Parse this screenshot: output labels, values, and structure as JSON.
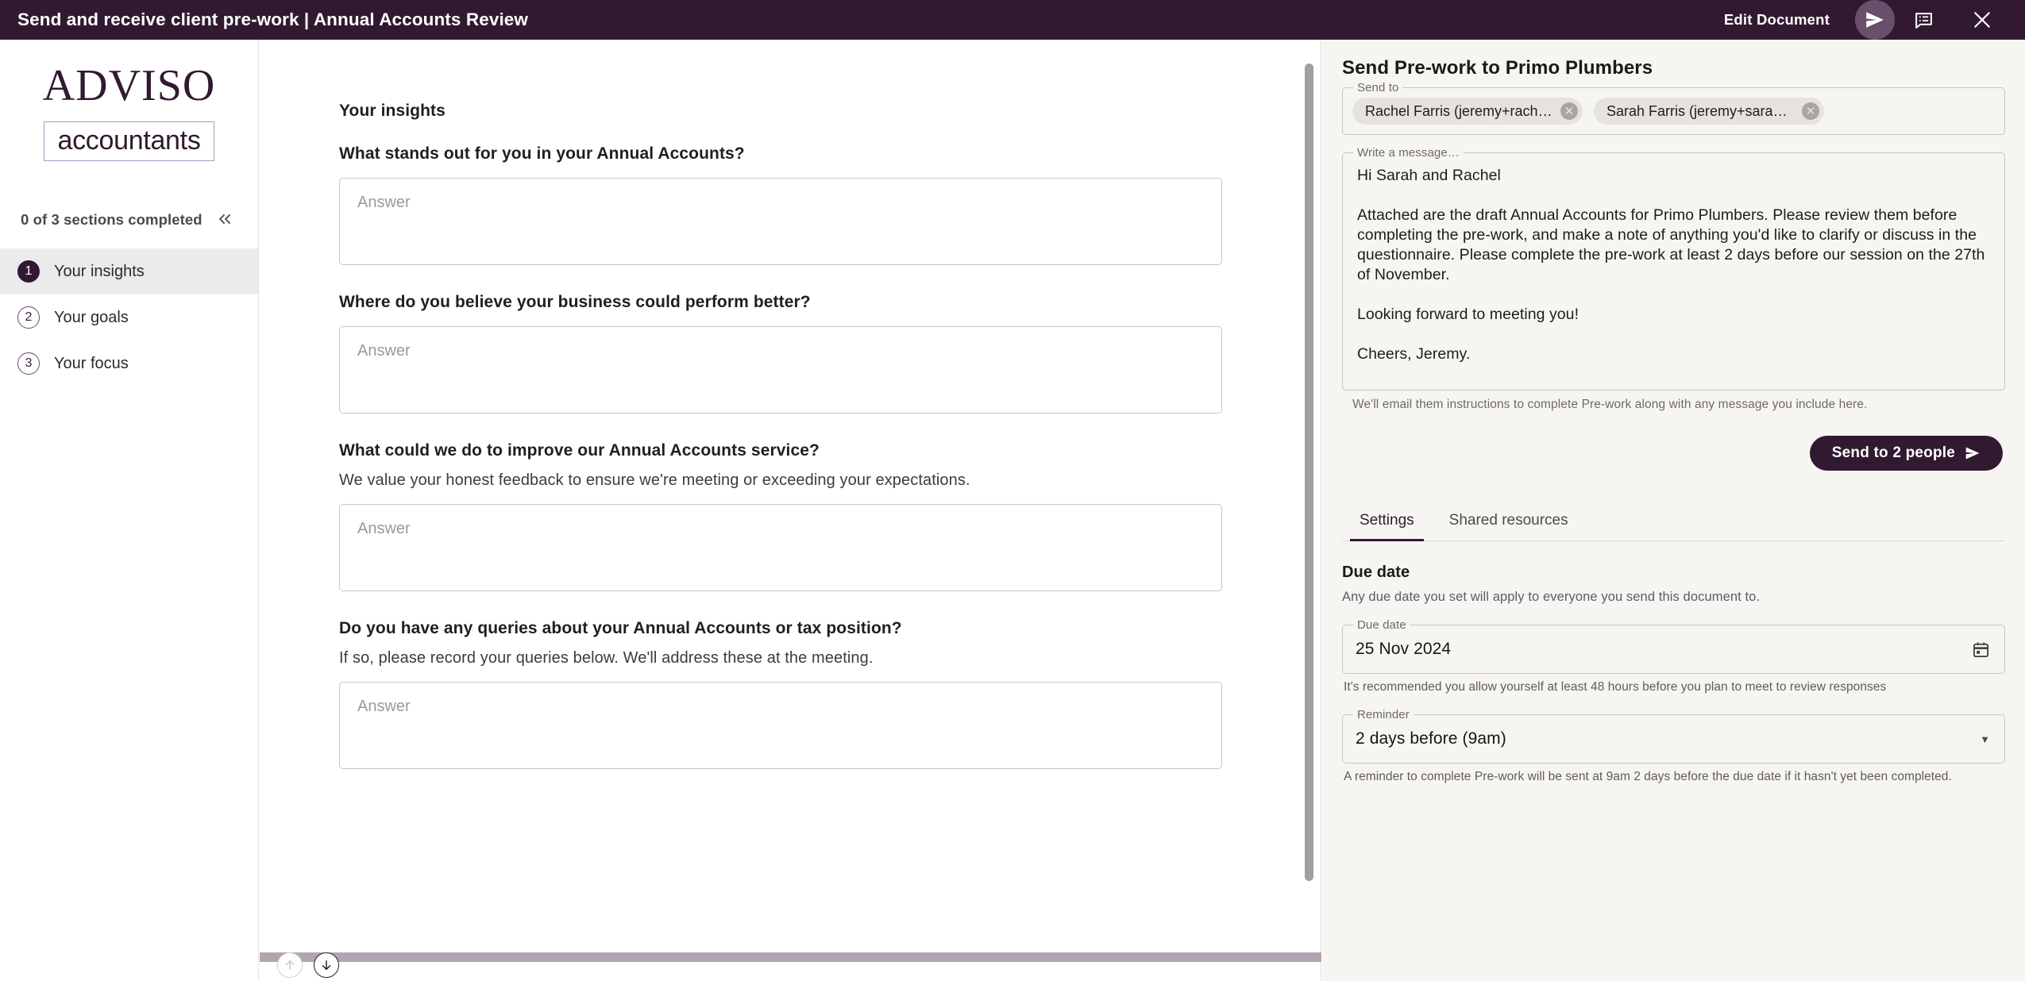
{
  "header": {
    "title": "Send and receive client pre-work | Annual Accounts Review",
    "edit_document_label": "Edit Document",
    "send_icon": "send-plane-icon",
    "comments_icon": "comments-icon",
    "close_icon": "close-icon",
    "background_color": "#311A31"
  },
  "sidebar": {
    "brand_name": "ADVISO",
    "brand_sub": "accountants",
    "progress_text": "0 of 3 sections completed",
    "collapse_icon": "chevron-double-left-icon",
    "items": [
      {
        "num": "1",
        "label": "Your insights",
        "active": true
      },
      {
        "num": "2",
        "label": "Your goals",
        "active": false
      },
      {
        "num": "3",
        "label": "Your focus",
        "active": false
      }
    ]
  },
  "document": {
    "section_title": "Your insights",
    "answer_placeholder": "Answer",
    "questions": [
      {
        "title": "What stands out for you in your Annual Accounts?",
        "sub": "",
        "answer": ""
      },
      {
        "title": "Where do you believe your business could perform better?",
        "sub": "",
        "answer": ""
      },
      {
        "title": "What could we do to improve our Annual Accounts service?",
        "sub": "We value your honest feedback to ensure we're meeting or exceeding your expectations.",
        "answer": ""
      },
      {
        "title": "Do you have any queries about your Annual Accounts or tax position?",
        "sub": "If so, please record your queries below. We'll address these at the meeting.",
        "answer": ""
      }
    ],
    "nav_up_icon": "arrow-up-icon",
    "nav_down_icon": "arrow-down-icon"
  },
  "panel": {
    "title": "Send Pre-work to Primo Plumbers",
    "send_to_legend": "Send to",
    "recipients": [
      {
        "label": "Rachel Farris (jeremy+rachelfa…"
      },
      {
        "label": "Sarah Farris (jeremy+sarahfarr…"
      }
    ],
    "message_legend": "Write a message…",
    "message_body": "Hi Sarah and Rachel\n\nAttached are the draft Annual Accounts for Primo Plumbers. Please review them before completing the pre-work, and make a note of anything you'd like to clarify or discuss in the questionnaire. Please complete the pre-work at least 2 days before our session on the 27th of November.\n\nLooking forward to meeting you!\n\nCheers, Jeremy.",
    "message_helper": "We'll email them instructions to complete Pre-work along with any message you include here.",
    "send_button_label": "Send to 2 people",
    "send_button_icon": "send-plane-icon",
    "send_button_color": "#311A31",
    "tabs": [
      {
        "label": "Settings",
        "active": true
      },
      {
        "label": "Shared resources",
        "active": false
      }
    ],
    "due_date_heading": "Due date",
    "due_date_sub": "Any due date you set will apply to everyone you send this document to.",
    "due_date_legend": "Due date",
    "due_date_value": "25 Nov 2024",
    "due_date_icon": "calendar-icon",
    "due_date_note": "It's recommended you allow yourself at least 48 hours before you plan to meet to review responses",
    "reminder_legend": "Reminder",
    "reminder_value": "2 days before (9am)",
    "reminder_icon": "chevron-down-icon",
    "reminder_note": "A reminder to complete Pre-work will be sent at 9am 2 days before the due date if it hasn't yet been completed.",
    "background_color": "#F7F5F2"
  }
}
